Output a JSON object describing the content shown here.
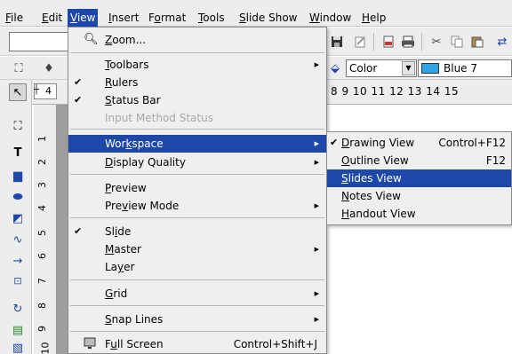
{
  "menubar": {
    "items": [
      {
        "pre": "",
        "ul": "F",
        "post": "ile"
      },
      {
        "pre": "",
        "ul": "E",
        "post": "dit"
      },
      {
        "pre": "",
        "ul": "V",
        "post": "iew"
      },
      {
        "pre": "",
        "ul": "I",
        "post": "nsert"
      },
      {
        "pre": "F",
        "ul": "o",
        "post": "rmat"
      },
      {
        "pre": "",
        "ul": "T",
        "post": "ools"
      },
      {
        "pre": "",
        "ul": "S",
        "post": "lide Show"
      },
      {
        "pre": "",
        "ul": "W",
        "post": "indow"
      },
      {
        "pre": "",
        "ul": "H",
        "post": "elp"
      }
    ]
  },
  "toolbar2": {
    "fill_type": "Color",
    "fill_color": "Blue 7"
  },
  "ruler": {
    "top_numbers": "8   9   10  11  12  13  14  15",
    "spin_value": "4",
    "left_numbers": [
      "1",
      "2",
      "3",
      "4",
      "5",
      "6",
      "7",
      "8",
      "9",
      "10"
    ]
  },
  "view_menu": {
    "zoom": {
      "pre": "",
      "ul": "Z",
      "post": "oom..."
    },
    "toolbars": {
      "pre": "",
      "ul": "T",
      "post": "oolbars"
    },
    "rulers": {
      "pre": "",
      "ul": "R",
      "post": "ulers"
    },
    "status_bar": {
      "pre": "",
      "ul": "S",
      "post": "tatus Bar"
    },
    "input_method_status": "Input Method Status",
    "workspace": {
      "pre": "Wor",
      "ul": "k",
      "post": "space"
    },
    "display_quality": {
      "pre": "",
      "ul": "D",
      "post": "isplay Quality"
    },
    "preview": {
      "pre": "",
      "ul": "P",
      "post": "review"
    },
    "preview_mode": {
      "pre": "Pre",
      "ul": "v",
      "post": "iew Mode"
    },
    "slide": {
      "pre": "Sl",
      "ul": "i",
      "post": "de"
    },
    "master": {
      "pre": "",
      "ul": "M",
      "post": "aster"
    },
    "layer": {
      "pre": "La",
      "ul": "y",
      "post": "er"
    },
    "grid": {
      "pre": "",
      "ul": "G",
      "post": "rid"
    },
    "snap_lines": {
      "pre": "",
      "ul": "S",
      "post": "nap Lines"
    },
    "full_screen": {
      "pre": "F",
      "ul": "u",
      "post": "ll Screen"
    },
    "full_screen_accel": "Control+Shift+J"
  },
  "workspace_submenu": {
    "drawing_view": {
      "pre": "",
      "ul": "D",
      "post": "rawing View"
    },
    "drawing_view_accel": "Control+F12",
    "outline_view": {
      "pre": "",
      "ul": "O",
      "post": "utline View"
    },
    "outline_view_accel": "F12",
    "slides_view": {
      "pre": "",
      "ul": "S",
      "post": "lides View"
    },
    "notes_view": {
      "pre": "",
      "ul": "N",
      "post": "otes View"
    },
    "handout_view": {
      "pre": "",
      "ul": "H",
      "post": "andout View"
    }
  },
  "colors": {
    "highlight": "#1d47a8",
    "menu_bg": "#efefef",
    "toolbar_bg": "#ededed",
    "swatch_blue7": "#2ea4e6"
  }
}
